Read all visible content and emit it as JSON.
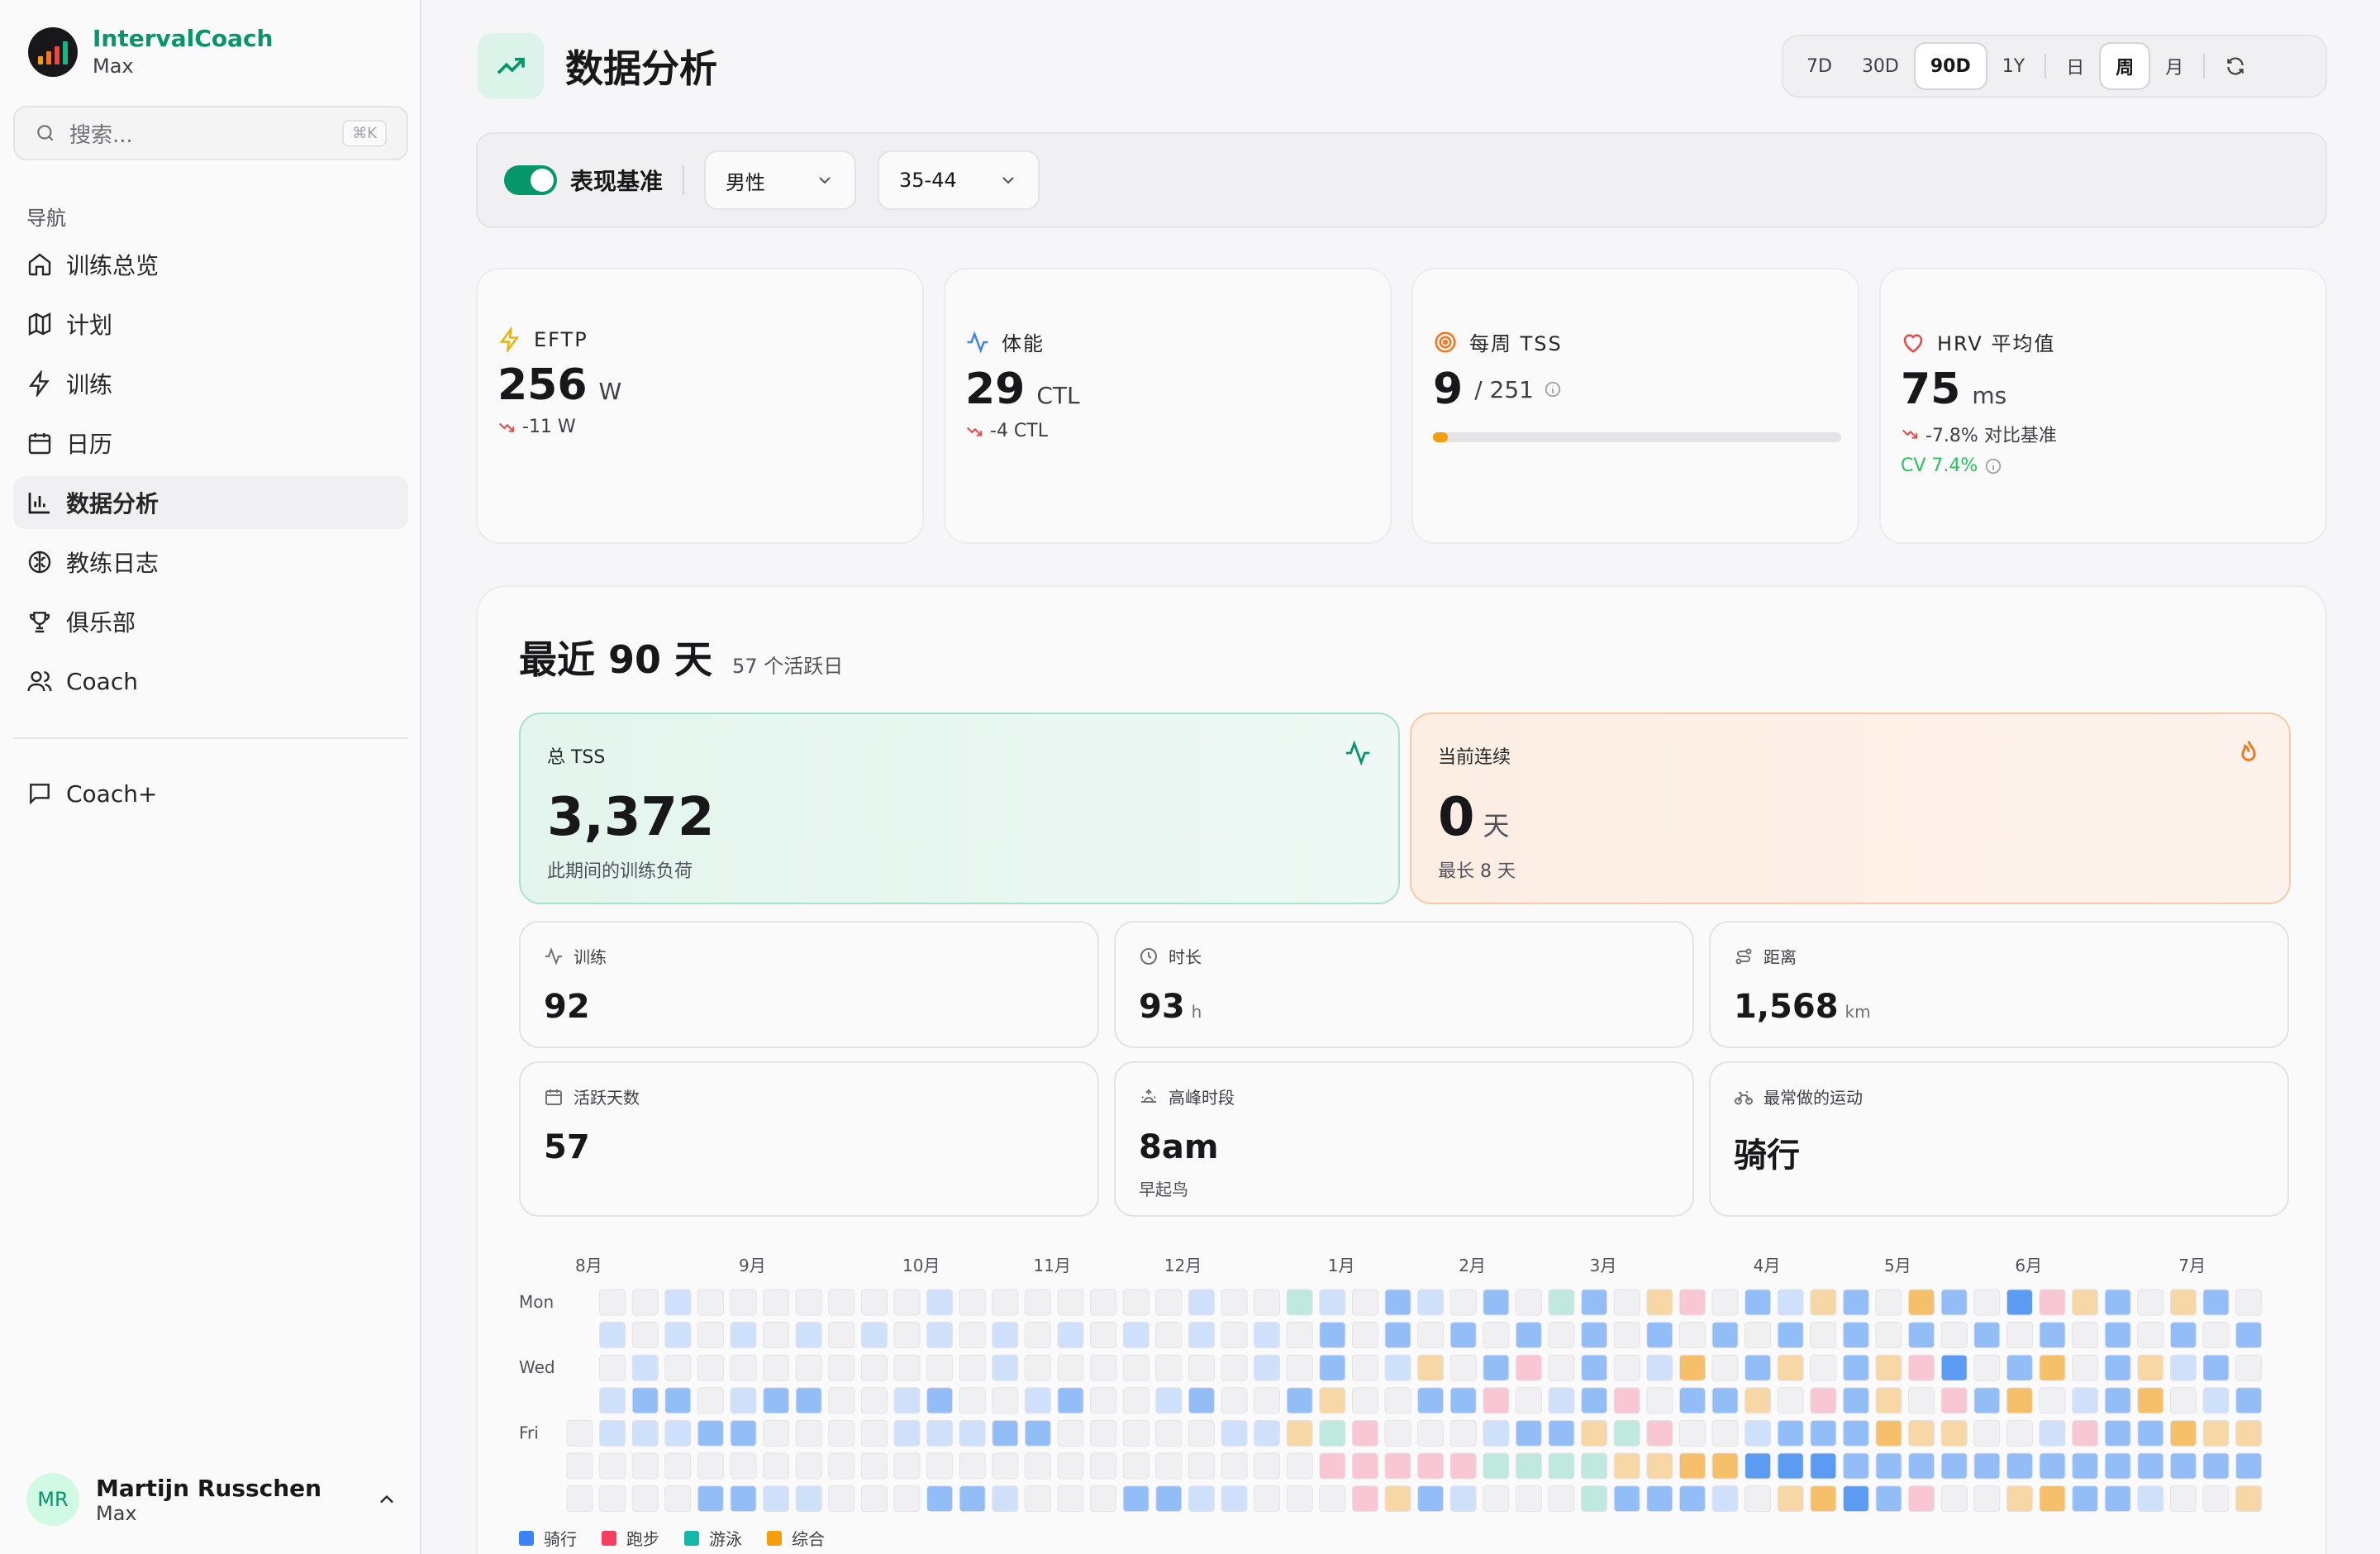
{
  "brand": {
    "name": "IntervalCoach",
    "sub": "Max"
  },
  "search": {
    "placeholder": "搜索...",
    "shortcut": "⌘K"
  },
  "nav": {
    "heading": "导航",
    "items": [
      {
        "label": "训练总览",
        "icon": "home-icon"
      },
      {
        "label": "计划",
        "icon": "map-icon"
      },
      {
        "label": "训练",
        "icon": "bolt-icon"
      },
      {
        "label": "日历",
        "icon": "calendar-icon"
      },
      {
        "label": "数据分析",
        "icon": "bar-chart-icon",
        "active": true
      },
      {
        "label": "教练日志",
        "icon": "brain-icon"
      },
      {
        "label": "俱乐部",
        "icon": "trophy-icon"
      },
      {
        "label": "Coach",
        "icon": "users-icon"
      }
    ],
    "coachplus": "Coach+"
  },
  "user": {
    "initials": "MR",
    "name": "Martijn Russchen",
    "sub": "Max"
  },
  "page": {
    "title": "数据分析"
  },
  "range": {
    "periods": [
      "7D",
      "30D",
      "90D",
      "1Y"
    ],
    "selected_period": "90D",
    "granularity": [
      "日",
      "周",
      "月"
    ],
    "selected_granularity": "周"
  },
  "filter": {
    "label": "表现基准",
    "enabled": true,
    "gender": "男性",
    "age": "35-44"
  },
  "kpis": {
    "eftp": {
      "title": "EFTP",
      "value": "256",
      "unit": "W",
      "delta": "-11 W"
    },
    "fitness": {
      "title": "体能",
      "value": "29",
      "unit": "CTL",
      "delta": "-4 CTL"
    },
    "weekly_tss": {
      "title": "每周 TSS",
      "value": "9",
      "target": "/ 251",
      "progress": 0.036
    },
    "hrv": {
      "title": "HRV 平均值",
      "value": "75",
      "unit": "ms",
      "delta": "-7.8% 对比基准",
      "cv": "CV 7.4%"
    }
  },
  "recent": {
    "title": "最近 90 天",
    "sub": "57 个活跃日",
    "total_tss": {
      "label": "总 TSS",
      "value": "3,372",
      "note": "此期间的训练负荷"
    },
    "streak": {
      "label": "当前连续",
      "value": "0",
      "unit": "天",
      "note": "最长 8 天"
    },
    "stats": {
      "workouts": {
        "label": "训练",
        "value": "92"
      },
      "duration": {
        "label": "时长",
        "value": "93",
        "unit": "h"
      },
      "distance": {
        "label": "距离",
        "value": "1,568",
        "unit": "km"
      },
      "active_days": {
        "label": "活跃天数",
        "value": "57"
      },
      "peak_time": {
        "label": "高峰时段",
        "value": "8am",
        "note": "早起鸟"
      },
      "top_sport": {
        "label": "最常做的运动",
        "value": "骑行"
      }
    }
  },
  "heatmap": {
    "months": [
      "8月",
      "9月",
      "10月",
      "11月",
      "12月",
      "1月",
      "2月",
      "3月",
      "4月",
      "5月",
      "6月",
      "7月"
    ],
    "days": [
      "Mon",
      "Wed",
      "Fri"
    ],
    "legend": [
      {
        "label": "骑行",
        "color": "#3b82f6"
      },
      {
        "label": "跑步",
        "color": "#f43f5e"
      },
      {
        "label": "游泳",
        "color": "#14b8a6"
      },
      {
        "label": "综合",
        "color": "#f59e0b"
      }
    ],
    "colors": {
      "empty": "#f0f0f2",
      "ride": "#93bdf7",
      "ride_light": "#cfe0fb",
      "ride_dark": "#5b9bf2",
      "run": "#f9c6d4",
      "swim": "#bfe8df",
      "mixed": "#f8d7a6",
      "mixed_dark": "#f6c06a"
    }
  }
}
